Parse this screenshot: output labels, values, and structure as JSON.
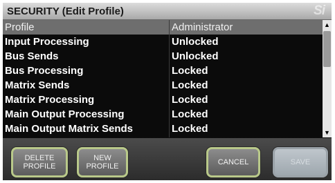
{
  "window": {
    "title": "SECURITY (Edit Profile)",
    "logo_text": "Si"
  },
  "table": {
    "headers": [
      "Profile",
      "Administrator"
    ],
    "rows": [
      {
        "profile": "Input Processing",
        "value": "Unlocked"
      },
      {
        "profile": "Bus Sends",
        "value": "Unlocked"
      },
      {
        "profile": "Bus Processing",
        "value": "Locked"
      },
      {
        "profile": "Matrix Sends",
        "value": "Locked"
      },
      {
        "profile": "Matrix Processing",
        "value": "Locked"
      },
      {
        "profile": "Main Output Processing",
        "value": "Locked"
      },
      {
        "profile": "Main Output Matrix Sends",
        "value": "Locked"
      }
    ]
  },
  "scrollbar": {
    "up_icon": "up-arrow",
    "down_icon": "down-arrow"
  },
  "buttons": {
    "delete_profile": "DELETE\nPROFILE",
    "new_profile": "NEW\nPROFILE",
    "cancel": "CANCEL",
    "save": "SAVE"
  },
  "colors": {
    "button_border": "#b9c98a",
    "background": "#0d0d0d",
    "header_row": "#6e6e6e"
  }
}
